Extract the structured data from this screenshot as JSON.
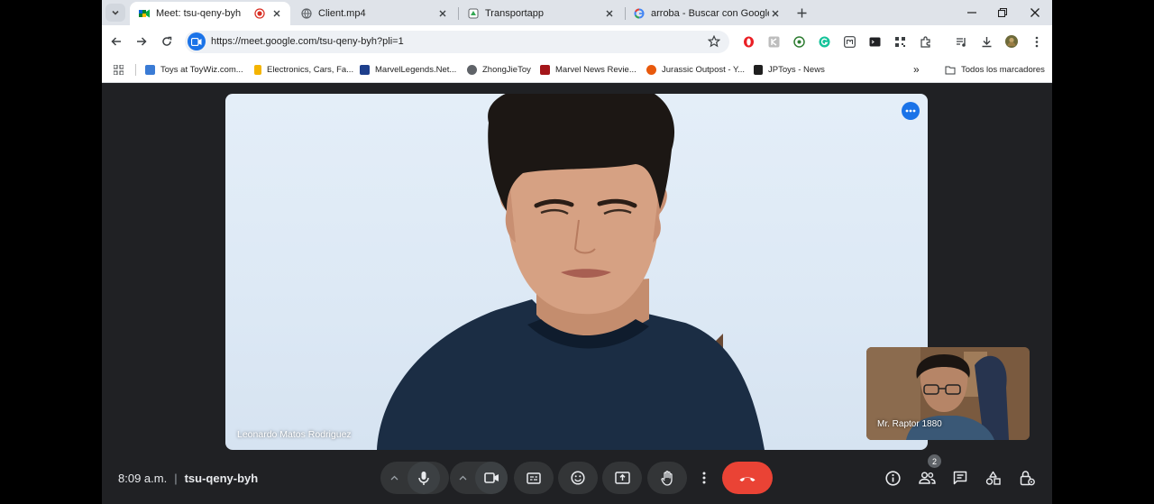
{
  "browser": {
    "tabs": [
      {
        "title": "Meet: tsu-qeny-byh",
        "active": true,
        "recording": true
      },
      {
        "title": "Client.mp4",
        "active": false
      },
      {
        "title": "Transportapp",
        "active": false
      },
      {
        "title": "arroba - Buscar con Google",
        "active": false
      }
    ],
    "url": "https://meet.google.com/tsu-qeny-byh?pli=1",
    "bookmarks": [
      "Toys at ToyWiz.com...",
      "Electronics, Cars, Fa...",
      "MarvelLegends.Net...",
      "ZhongJieToy",
      "Marvel News Revie...",
      "Jurassic Outpost - Y...",
      "JPToys - News"
    ],
    "all_bookmarks": "Todos los marcadores",
    "overflow": "»"
  },
  "meet": {
    "main_participant": "Leonardo Matos Rodriguez",
    "self_participant": "Mr. Raptor 1880",
    "time": "8:09 a.m.",
    "separator": "|",
    "meeting_code": "tsu-qeny-byh",
    "participant_count": "2",
    "colors": {
      "hangup": "#ea4335",
      "accent": "#1a73e8",
      "bar": "#202124"
    }
  },
  "icons": [
    "tab-search-icon",
    "meet-icon",
    "record-icon",
    "close-icon",
    "globe-icon",
    "new-tab-icon",
    "minimize-icon",
    "restore-icon",
    "back-icon",
    "forward-icon",
    "reload-icon",
    "star-icon",
    "extensions-icon",
    "download-icon",
    "apps-icon",
    "folder-icon",
    "mic-icon",
    "camera-icon",
    "captions-icon",
    "emoji-icon",
    "present-icon",
    "raise-hand-icon",
    "more-options-icon",
    "hangup-icon",
    "info-icon",
    "people-icon",
    "chat-icon",
    "activities-icon",
    "host-controls-icon"
  ]
}
